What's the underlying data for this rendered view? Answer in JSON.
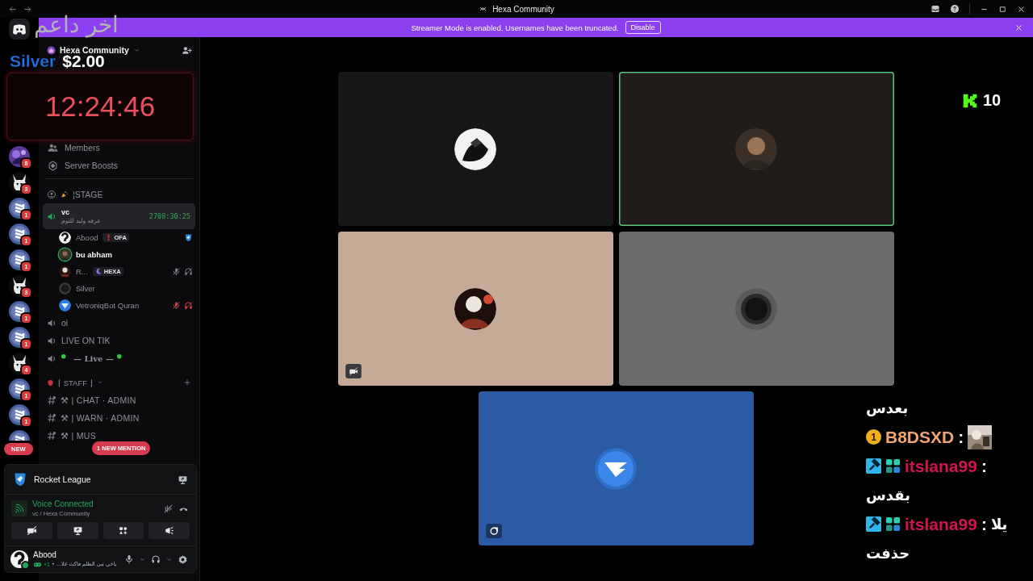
{
  "window": {
    "title": "Hexa Community"
  },
  "banner": {
    "message": "Streamer Mode is enabled. Usernames have been truncated.",
    "button": "Disable"
  },
  "servers": [
    {
      "kind": "home"
    },
    {
      "kind": "purple",
      "badge": "8"
    },
    {
      "kind": "horned",
      "badge": "3"
    },
    {
      "kind": "logo",
      "badge": "1"
    },
    {
      "kind": "logo",
      "badge": "1"
    },
    {
      "kind": "logo",
      "badge": "1"
    },
    {
      "kind": "horned",
      "badge": "3"
    },
    {
      "kind": "logo",
      "badge": "1"
    },
    {
      "kind": "logo",
      "badge": "1"
    },
    {
      "kind": "horned",
      "badge": "4"
    },
    {
      "kind": "logo",
      "badge": "1"
    },
    {
      "kind": "logo",
      "badge": "1"
    },
    {
      "kind": "logo"
    }
  ],
  "server": {
    "name": "Hexa Community"
  },
  "menu": [
    {
      "kind": "members",
      "label": "Members"
    },
    {
      "kind": "boosts",
      "label": "Server Boosts"
    }
  ],
  "channels": [
    {
      "kind": "stage",
      "name": "¦STAGE"
    },
    {
      "kind": "voice",
      "name": "vc",
      "selected": true,
      "subtitle": "غرفه وليد للنوم",
      "timer": "2708:30:25",
      "members": [
        {
          "name": "Abood",
          "avatar": {
            "kind": "question"
          },
          "speaking": false,
          "tag": {
            "kind": "red",
            "text": "OFA"
          },
          "icons": [
            {
              "kind": "rocket"
            }
          ]
        },
        {
          "name": "bu abham",
          "speaking": true
        },
        {
          "name": "R...",
          "avatar": {
            "kind": "figure"
          },
          "speaking": false,
          "tag": {
            "kind": "purple",
            "text": "HEXA"
          },
          "icons": [
            {
              "kind": "mute"
            },
            {
              "kind": "deafen"
            }
          ]
        },
        {
          "name": "Silver",
          "avatar": {
            "kind": "gray"
          },
          "speaking": false
        },
        {
          "name": "VetroniqBot Quran",
          "avatar": {
            "kind": "bot"
          },
          "speaking": false,
          "icons": [
            {
              "kind": "server-mute"
            },
            {
              "kind": "server-deafen"
            }
          ]
        }
      ]
    },
    {
      "kind": "voice",
      "name": "oi",
      "selected": false
    },
    {
      "kind": "voice",
      "name": "LIVE ON TIK",
      "selected": false
    },
    {
      "kind": "voice",
      "name": "— Live —",
      "selected": false,
      "dots": true
    },
    {
      "kind": "category",
      "name": "⌈ STAFF ⌋"
    },
    {
      "kind": "text",
      "name": "⚒ | CHAT · ADMIN"
    },
    {
      "kind": "text",
      "name": "⚒ | WARN · ADMIN"
    },
    {
      "kind": "text",
      "name": "⚒ | MUS"
    }
  ],
  "pills": {
    "new": "NEW",
    "mention": "1 NEW MENTION"
  },
  "activity": {
    "name": "Rocket League"
  },
  "voice": {
    "status": "Voice Connected",
    "location": "vc / Hexa Community"
  },
  "user": {
    "name": "Abood",
    "activity_count": "+1",
    "status": "• ...ياخي تبي الظلم فاكث غلا"
  },
  "tiles": [
    {
      "color": "#161616",
      "avatar": {
        "kind": "mono"
      },
      "speaking": false
    },
    {
      "color": "#1f1c1a",
      "avatar": {
        "kind": "person"
      },
      "speaking": true
    },
    {
      "color": "#c5ab97",
      "avatar": {
        "kind": "figure"
      },
      "speaking": false,
      "corner": {
        "kind": "video-off"
      }
    },
    {
      "color": "#6b6b69",
      "avatar": {
        "kind": "blur"
      },
      "speaking": false
    },
    {
      "color": "#2b5ba5",
      "avatar": {
        "kind": "bird"
      },
      "speaking": false,
      "corner": {
        "kind": "activity"
      }
    }
  ],
  "overlay": {
    "donor_title": "اخر داعم",
    "donor_name": "Silver",
    "donor_amount": "$2.00",
    "clock": "12:24:46",
    "kick_count": "10",
    "chat": [
      {
        "kind": "text",
        "text": "بعدس"
      },
      {
        "kind": "user",
        "badges": [
          {
            "kind": "coin",
            "text": "1"
          }
        ],
        "name": "B8DSXD",
        "color": "#f2a574",
        "sep": ":",
        "sticker": true
      },
      {
        "kind": "user",
        "badges": [
          {
            "kind": "mod"
          },
          {
            "kind": "sub"
          }
        ],
        "name": "itslana99",
        "color": "#d3134f",
        "sep": ":"
      },
      {
        "kind": "text",
        "text": "بقدس"
      },
      {
        "kind": "user",
        "badges": [
          {
            "kind": "mod"
          },
          {
            "kind": "sub"
          }
        ],
        "name": "itslana99",
        "color": "#d3134f",
        "sep": ":",
        "text": "يلا"
      },
      {
        "kind": "text",
        "text": "حذفت"
      }
    ]
  }
}
